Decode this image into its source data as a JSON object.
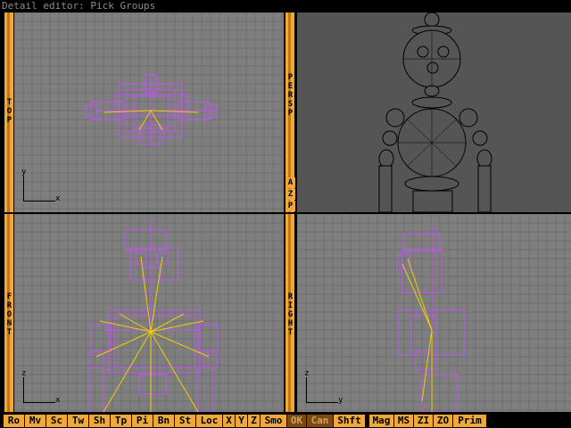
{
  "window": {
    "title": "Detail editor: Pick Groups"
  },
  "viewports": {
    "top": {
      "label": "TOP",
      "axis_v": "y",
      "axis_h": "x"
    },
    "persp": {
      "label": "PERSP",
      "buttons": [
        "A",
        "Z",
        "P"
      ]
    },
    "front": {
      "label": "FRONT",
      "axis_v": "z",
      "axis_h": "x"
    },
    "right": {
      "label": "RIGHT",
      "axis_v": "z",
      "axis_h": "y"
    }
  },
  "toolbar": {
    "buttons": [
      {
        "label": "Ro"
      },
      {
        "label": "Mv"
      },
      {
        "label": "Sc"
      },
      {
        "label": "Tw"
      },
      {
        "label": "Sh"
      },
      {
        "label": "Tp"
      },
      {
        "label": "Pi"
      },
      {
        "label": "Bn"
      },
      {
        "label": "St"
      },
      {
        "label": "Loc"
      },
      {
        "label": "X"
      },
      {
        "label": "Y"
      },
      {
        "label": "Z"
      },
      {
        "label": "Smo"
      },
      {
        "label": "OK"
      },
      {
        "label": "Can"
      },
      {
        "label": "Shft"
      },
      {
        "label": "Mag"
      },
      {
        "label": "MS"
      },
      {
        "label": "ZI"
      },
      {
        "label": "ZO"
      },
      {
        "label": "Prim"
      }
    ]
  },
  "colors": {
    "accent": "#f0a838",
    "viewport_bg": "#7f7f7f",
    "wire": "#c050f0",
    "bone": "#f0d000"
  }
}
